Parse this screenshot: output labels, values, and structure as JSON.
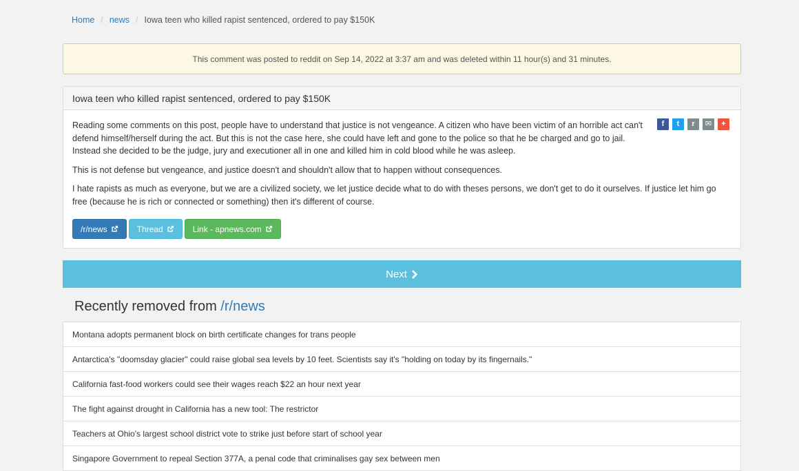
{
  "breadcrumb": {
    "home": "Home",
    "sep1": "/",
    "section": "news",
    "sep2": "/",
    "current": "Iowa teen who killed rapist sentenced, ordered to pay $150K"
  },
  "alert": {
    "text": "This comment was posted to reddit on Sep 14, 2022 at 3:37 am and was deleted within 11 hour(s) and 31 minutes."
  },
  "post": {
    "title": "Iowa teen who killed rapist sentenced, ordered to pay $150K",
    "paragraphs": [
      "Reading some comments on this post, people have to understand that justice is not vengeance. A citizen who have been victim of an horrible act can't defend himself/herself during the act. But this is not the case here, she could have left and gone to the police so that he be charged and go to jail. Instead she decided to be the judge, jury and executioner all in one and killed him in cold blood while he was asleep.",
      "This is not defense but vengeance, and justice doesn't and shouldn't allow that to happen without consequences.",
      "I hate rapists as much as everyone, but we are a civilized society, we let justice decide what to do with theses persons, we don't get to do it ourselves. If justice let him go free (because he is rich or connected or something) then it's different of course."
    ],
    "buttons": {
      "subreddit": "/r/news",
      "thread": "Thread",
      "link": "Link - apnews.com"
    },
    "share_icons": [
      {
        "name": "facebook-icon",
        "glyph": "f",
        "color": "#3b5998"
      },
      {
        "name": "twitter-icon",
        "glyph": "t",
        "color": "#1da1f2"
      },
      {
        "name": "reddit-icon",
        "glyph": "r",
        "color": "#7f8c8d"
      },
      {
        "name": "email-icon",
        "glyph": "✉",
        "color": "#7f8c8d"
      },
      {
        "name": "add-share-icon",
        "glyph": "+",
        "color": "#f0533e"
      }
    ]
  },
  "next": {
    "label": "Next"
  },
  "recent": {
    "title_prefix": "Recently removed from ",
    "title_link": "/r/news",
    "items": [
      "Montana adopts permanent block on birth certificate changes for trans people",
      "Antarctica's \"doomsday glacier\" could raise global sea levels by 10 feet. Scientists say it's \"holding on today by its fingernails.\"",
      "California fast-food workers could see their wages reach $22 an hour next year",
      "The fight against drought in California has a new tool: The restrictor",
      "Teachers at Ohio's largest school district vote to strike just before start of school year",
      "Singapore Government to repeal Section 377A, a penal code that criminalises gay sex between men"
    ]
  },
  "colors": {
    "link": "#337ab7",
    "info": "#5bc0de",
    "success": "#5cb85c",
    "warning_bg": "#fcf8e3"
  }
}
